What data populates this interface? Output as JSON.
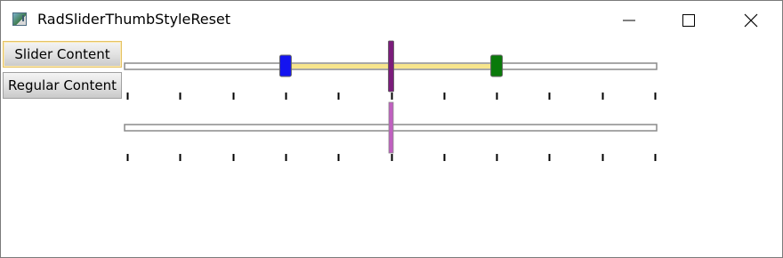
{
  "window": {
    "title": "RadSliderThumbStyleReset"
  },
  "buttons": {
    "slider_content": "Slider Content",
    "regular_content": "Regular Content"
  },
  "sliders": [
    {
      "name": "range-slider",
      "min": 0,
      "max": 10,
      "ticks": 11,
      "selection_start": 3,
      "selection_end": 7,
      "value": 5,
      "colors": {
        "start_thumb": "#1414f0",
        "end_thumb": "#0a7a0a",
        "middle_thumb": "#7b1c7b",
        "selection": "#f7e58c"
      }
    },
    {
      "name": "plain-slider",
      "min": 0,
      "max": 10,
      "ticks": 11,
      "value": 5,
      "colors": {
        "thumb": "#c060c0"
      }
    }
  ],
  "icons": {
    "app": "app-window-icon",
    "minimize": "minimize-icon",
    "maximize": "maximize-icon",
    "close": "close-icon"
  }
}
